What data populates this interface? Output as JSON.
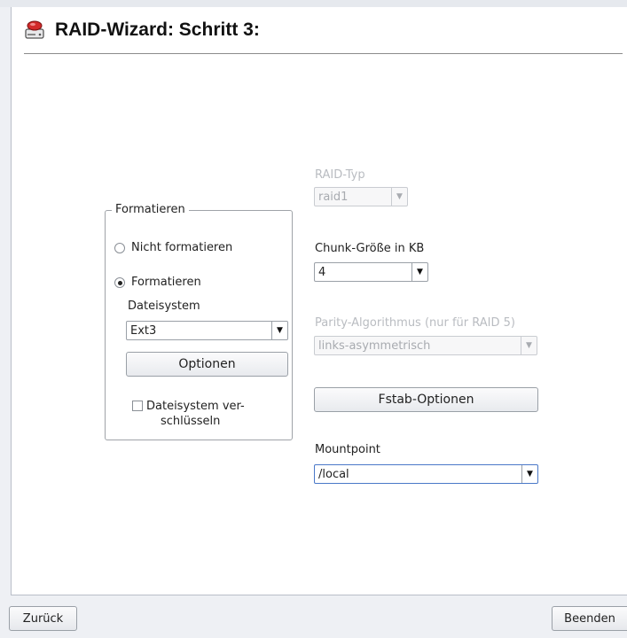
{
  "header": {
    "title": "RAID-Wizard: Schritt 3:",
    "icon": "harddisk-icon"
  },
  "format_group": {
    "legend": "Formatieren",
    "radio_no_format": "Nicht formatieren",
    "radio_format": "Formatieren",
    "selected": "Formatieren",
    "filesystem_label": "Dateisystem",
    "filesystem_value": "Ext3",
    "options_button": "Optionen",
    "encrypt_line1": "Dateisystem ver-",
    "encrypt_line2": "schlüsseln",
    "encrypt_checked": false
  },
  "raid_type": {
    "label": "RAID-Typ",
    "value": "raid1",
    "enabled": false
  },
  "chunk_size": {
    "label": "Chunk-Größe in KB",
    "value": "4"
  },
  "parity": {
    "label": "Parity-Algorithmus (nur für RAID 5)",
    "value": "links-asymmetrisch",
    "enabled": false
  },
  "fstab_button": "Fstab-Optionen",
  "mountpoint": {
    "label": "Mountpoint",
    "value": "/local"
  },
  "footer": {
    "back": "Zurück",
    "finish": "Beenden"
  },
  "colors": {
    "background": "#ffffff",
    "frame": "#eef0f4",
    "focus": "#4a78c8",
    "disabled_text": "#b9bcc1"
  }
}
